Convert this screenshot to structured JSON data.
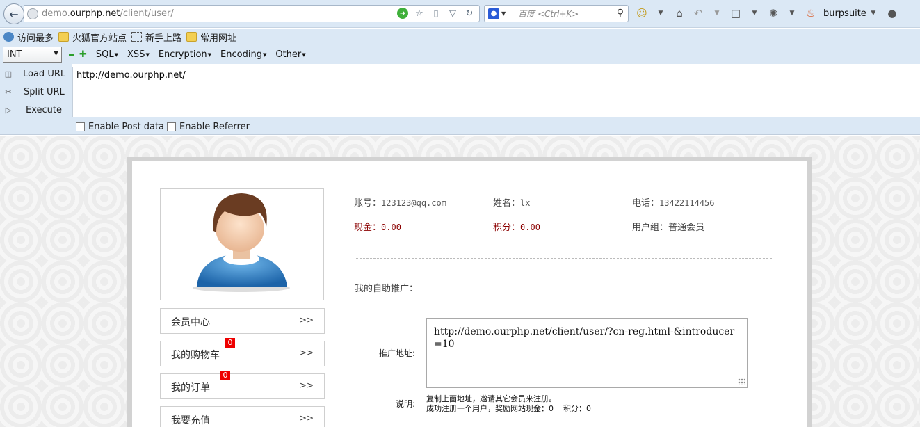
{
  "browser": {
    "url_host_prefix": "demo.",
    "url_host": "ourphp.net",
    "url_path": "/client/user/",
    "search_placeholder": "百度 <Ctrl+K>",
    "burp_label": "burpsuite"
  },
  "bookmarks": [
    "访问最多",
    "火狐官方站点",
    "新手上路",
    "常用网址"
  ],
  "hackbar": {
    "select_value": "INT",
    "menus": [
      "SQL",
      "XSS",
      "Encryption",
      "Encoding",
      "Other"
    ],
    "side": [
      "Load URL",
      "Split URL",
      "Execute"
    ],
    "url_value": "http://demo.ourphp.net/",
    "enable_post": "Enable Post data",
    "enable_referrer": "Enable Referrer"
  },
  "user": {
    "account_label": "账号：",
    "account": "123123@qq.com",
    "name_label": "姓名：",
    "name": "lx",
    "phone_label": "电话：",
    "phone": "13422114456",
    "cash_label": "现金：",
    "cash": "0.00",
    "points_label": "积分：",
    "points": "0.00",
    "group_label": "用户组：",
    "group": "普通会员"
  },
  "sidebar": [
    {
      "label": "会员中心",
      "arrow": ">>",
      "badge": ""
    },
    {
      "label": "我的购物车",
      "arrow": ">>",
      "badge": "0"
    },
    {
      "label": "我的订单",
      "arrow": ">>",
      "badge": "0"
    },
    {
      "label": "我要充值",
      "arrow": ">>",
      "badge": ""
    }
  ],
  "promo": {
    "title": "我的自助推广：",
    "link_label": "推广地址:",
    "link": "http://demo.ourphp.net/client/user/?cn-reg.html-&introducer=10",
    "note_label": "说明:",
    "note_line1": "复制上面地址，邀请其它会员来注册。",
    "note_line2": "成功注册一个用户，奖励网站现金：0    积分：0"
  }
}
